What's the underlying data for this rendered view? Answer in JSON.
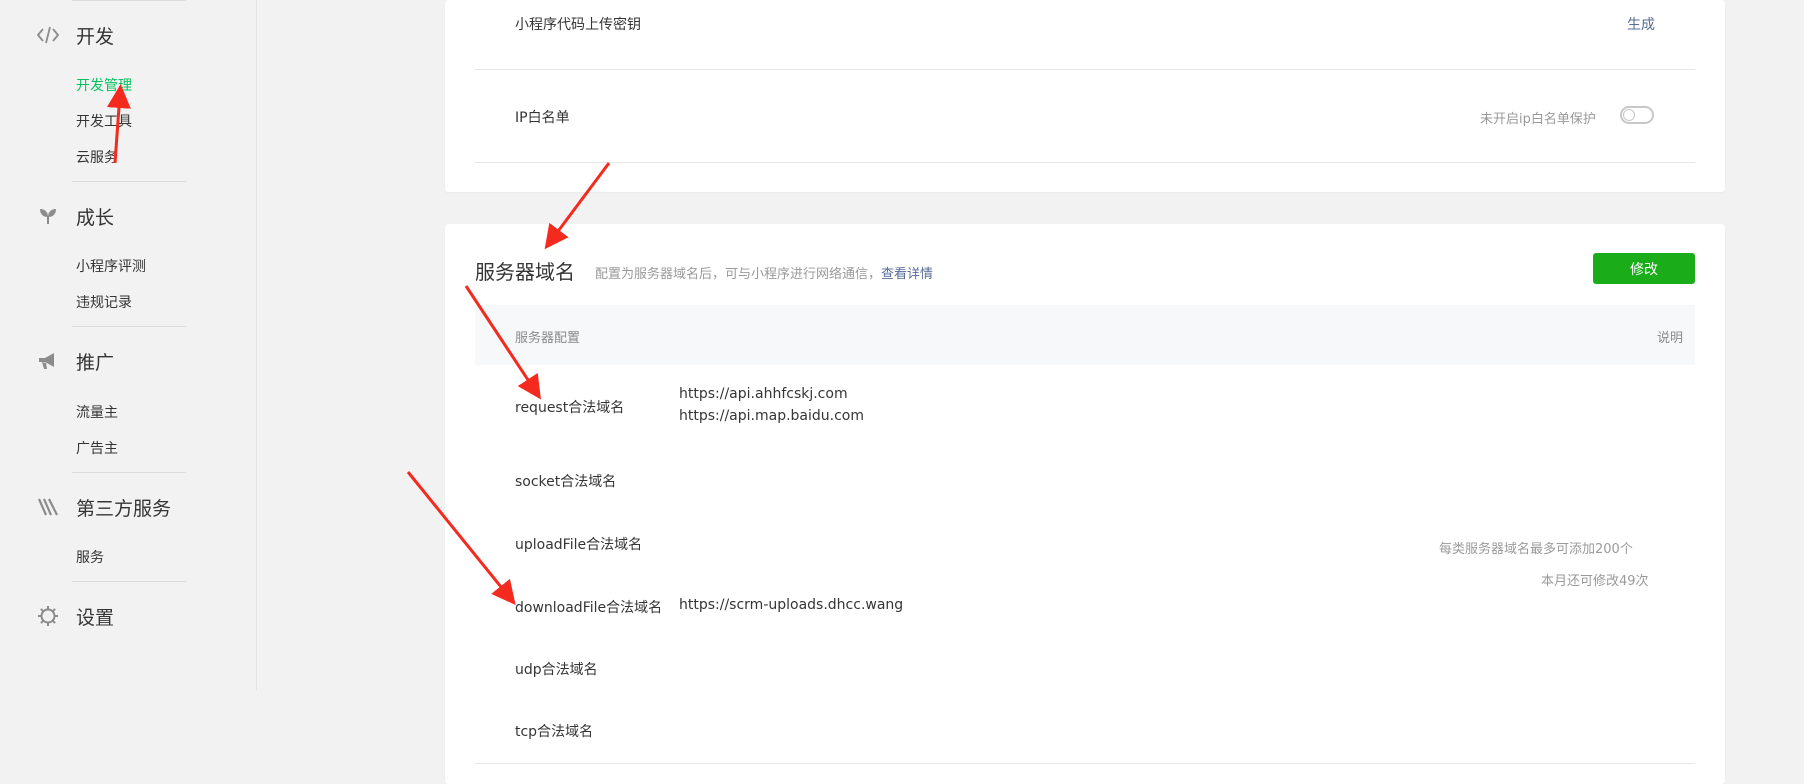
{
  "sidebar": {
    "groups": [
      {
        "title": "开发",
        "icon": "code-icon",
        "items": [
          "开发管理",
          "开发工具",
          "云服务"
        ]
      },
      {
        "title": "成长",
        "icon": "sprout-icon",
        "items": [
          "小程序评测",
          "违规记录"
        ]
      },
      {
        "title": "推广",
        "icon": "megaphone-icon",
        "items": [
          "流量主",
          "广告主"
        ]
      },
      {
        "title": "第三方服务",
        "icon": "third-party-icon",
        "items": [
          "服务"
        ]
      },
      {
        "title": "设置",
        "icon": "gear-icon",
        "items": []
      }
    ],
    "active_item": "开发管理"
  },
  "top_card": {
    "upload_key_label": "小程序代码上传密钥",
    "upload_key_action": "生成",
    "ip_whitelist_label": "IP白名单",
    "ip_whitelist_status": "未开启ip白名单保护",
    "ip_whitelist_enabled": false
  },
  "server_domain": {
    "title": "服务器域名",
    "description": "配置为服务器域名后，可与小程序进行网络通信，",
    "detail_link": "查看详情",
    "edit_button": "修改",
    "header_config": "服务器配置",
    "header_note": "说明",
    "rows": [
      {
        "label": "request合法域名",
        "values": [
          "https://api.ahhfcskj.com",
          "https://api.map.baidu.com"
        ]
      },
      {
        "label": "socket合法域名",
        "values": []
      },
      {
        "label": "uploadFile合法域名",
        "values": []
      },
      {
        "label": "downloadFile合法域名",
        "values": [
          "https://scrm-uploads.dhcc.wang"
        ]
      },
      {
        "label": "udp合法域名",
        "values": []
      },
      {
        "label": "tcp合法域名",
        "values": []
      }
    ],
    "note_line1": "每类服务器域名最多可添加200个",
    "note_line2": "本月还可修改49次"
  },
  "colors": {
    "active": "#07c160",
    "link": "#576b95",
    "button": "#1aad19",
    "annotation_arrow": "#f52a1e"
  }
}
